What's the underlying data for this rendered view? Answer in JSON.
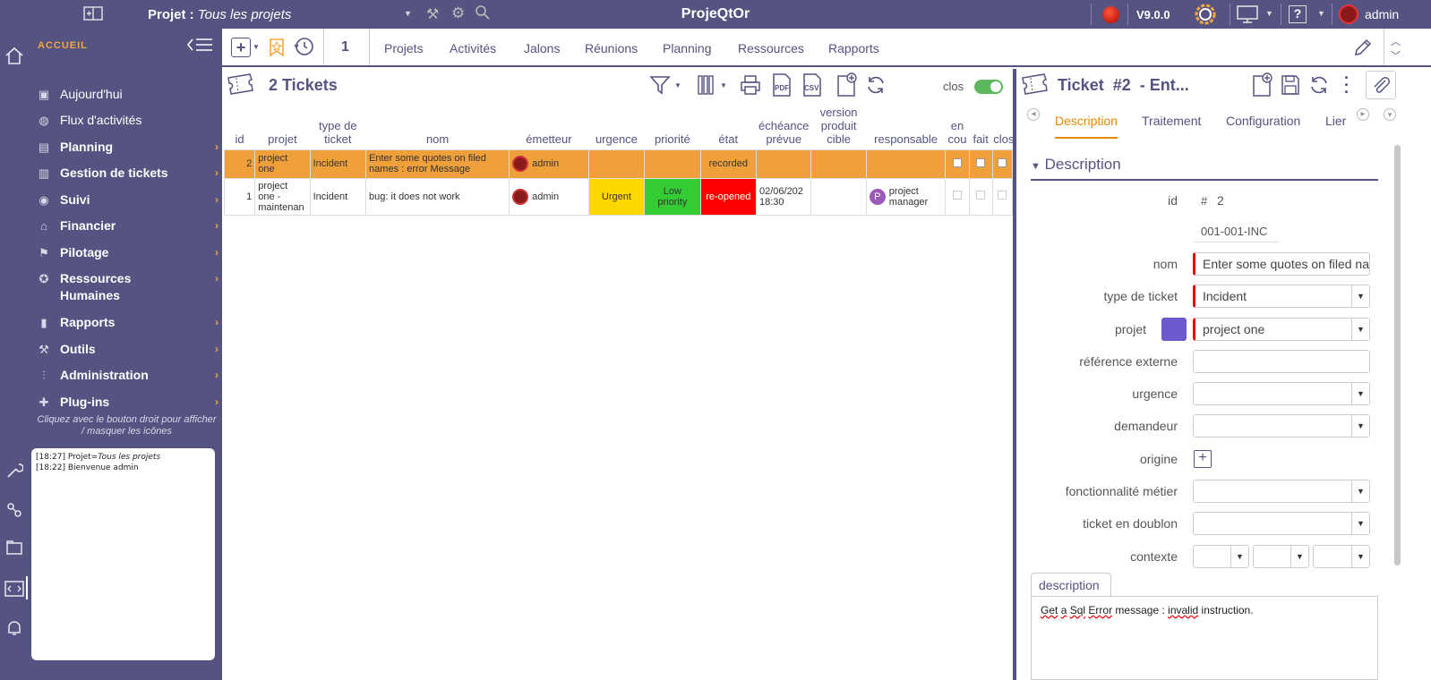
{
  "topbar": {
    "project_label": "Projet :",
    "project_value": "Tous les projets",
    "app_title": "ProjeQtOr",
    "version": "V9.0.0",
    "user": "admin"
  },
  "sidebar": {
    "accueil": "ACCUEIL",
    "items": [
      {
        "label": "Aujourd'hui",
        "icon": "today-icon",
        "arrow": ""
      },
      {
        "label": "Flux d'activités",
        "icon": "activity-stream-icon",
        "arrow": ""
      },
      {
        "label": "Planning",
        "icon": "planning-icon",
        "arrow": "›"
      },
      {
        "label": "Gestion de tickets",
        "icon": "tickets-icon",
        "arrow": "›"
      },
      {
        "label": "Suivi",
        "icon": "eye-icon",
        "arrow": "›"
      },
      {
        "label": "Financier",
        "icon": "bank-icon",
        "arrow": "›"
      },
      {
        "label": "Pilotage",
        "icon": "steering-icon",
        "arrow": "›"
      },
      {
        "label": "Ressources Humaines",
        "icon": "hr-icon",
        "arrow": "›"
      },
      {
        "label": "Rapports",
        "icon": "reports-icon",
        "arrow": "›"
      },
      {
        "label": "Outils",
        "icon": "tools-icon",
        "arrow": "›"
      },
      {
        "label": "Administration",
        "icon": "admin-icon",
        "arrow": "›"
      },
      {
        "label": "Plug-ins",
        "icon": "plugin-icon",
        "arrow": "›"
      }
    ],
    "hint": "Cliquez avec le bouton droit pour afficher / masquer les icônes",
    "log": [
      {
        "time": "[18:27]",
        "text": "Projet=",
        "italic": "Tous les projets"
      },
      {
        "time": "[18:22]",
        "text": "Bienvenue admin",
        "italic": ""
      }
    ]
  },
  "toolbar": {
    "counter": "1",
    "nav": [
      "Projets",
      "Activités",
      "Jalons",
      "Réunions",
      "Planning",
      "Ressources",
      "Rapports"
    ]
  },
  "list": {
    "title": "2 Tickets",
    "closed_label": "clos",
    "columns": [
      "id",
      "projet",
      "type de ticket",
      "nom",
      "émetteur",
      "urgence",
      "priorité",
      "état",
      "échéance prévue",
      "version produit cible",
      "responsable",
      "en cou",
      "fait",
      "clos"
    ],
    "rows": [
      {
        "id": "2",
        "projet": "project one",
        "type": "Incident",
        "nom": "Enter some quotes on filed names : error Message",
        "emetteur": "admin",
        "urgence": "",
        "priorite": "",
        "etat": "recorded",
        "echeance": "",
        "version": "",
        "responsable": ""
      },
      {
        "id": "1",
        "projet": "project one - maintenan",
        "type": "Incident",
        "nom": "bug: it does not work",
        "emetteur": "admin",
        "urgence": "Urgent",
        "priorite": "Low priority",
        "etat": "re-opened",
        "echeance": "02/06/202 18:30",
        "version": "",
        "responsable": "project manager",
        "responsable_initial": "P"
      }
    ]
  },
  "detail": {
    "title": "Ticket  #2  - Ent...",
    "tabs": [
      "Description",
      "Traitement",
      "Configuration",
      "Lier"
    ],
    "section": "Description",
    "fields": {
      "id_label": "id",
      "id_hash": "#",
      "id_value": "2",
      "reference": "001-001-INC",
      "nom_label": "nom",
      "nom_value": "Enter some quotes on filed names : error Message",
      "type_label": "type de ticket",
      "type_value": "Incident",
      "projet_label": "projet",
      "projet_value": "project one",
      "ref_ext_label": "référence externe",
      "urgence_label": "urgence",
      "demandeur_label": "demandeur",
      "origine_label": "origine",
      "fonct_label": "fonctionnalité métier",
      "doublon_label": "ticket en doublon",
      "contexte_label": "contexte"
    },
    "description_tab": "description",
    "description_words": [
      "Get",
      "a",
      "Sql",
      "Error",
      "message",
      ":",
      "invalid",
      "instruction."
    ]
  },
  "colors": {
    "brand": "#545381",
    "accent": "#f3a63c",
    "selected_row": "#f0a03a",
    "urgent": "#ffd700",
    "low_priority": "#33cc33",
    "reopened": "#ff0000"
  }
}
